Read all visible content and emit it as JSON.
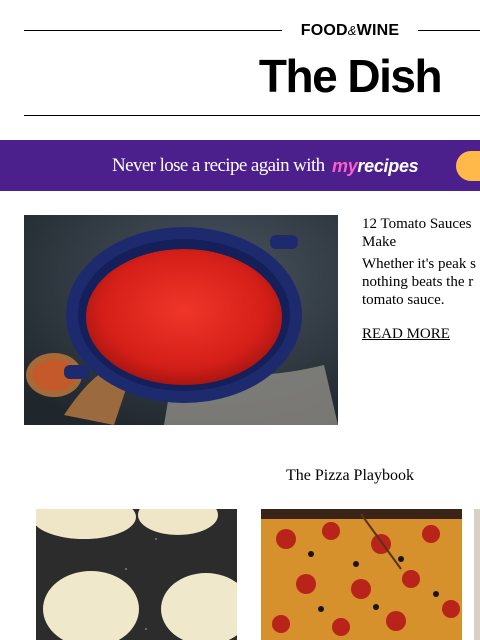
{
  "header": {
    "brand_main": "FOOD",
    "brand_amp": "&",
    "brand_end": "WINE",
    "title": "The Dish"
  },
  "banner": {
    "text": "Never lose a recipe again with",
    "logo_my": "my",
    "logo_recipes": "recipes",
    "colors": {
      "background": "#4b1f8c",
      "logo_accent": "#ff5cc8",
      "button": "#ffb94a"
    }
  },
  "article": {
    "title": "12 Tomato Sauces Make",
    "description": "Whether it's peak s nothing beats the r tomato sauce.",
    "read_more": "READ MORE"
  },
  "section": {
    "title": "The Pizza Playbook"
  }
}
